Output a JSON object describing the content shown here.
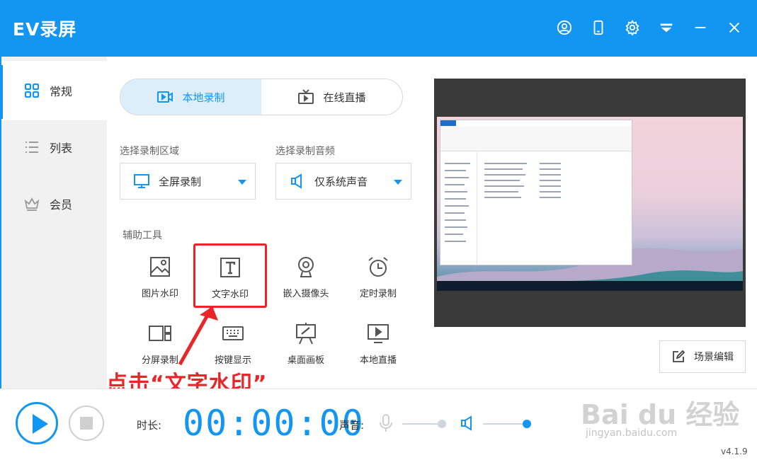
{
  "app": {
    "title": "EV录屏",
    "accent": "#1296f1",
    "version": "v4.1.9"
  },
  "titlebar_icons": [
    "user-icon",
    "phone-icon",
    "settings-icon",
    "skin-icon",
    "minimize-icon",
    "close-icon"
  ],
  "sidebar": {
    "items": [
      {
        "label": "常规",
        "icon": "grid-icon",
        "active": true
      },
      {
        "label": "列表",
        "icon": "list-icon",
        "active": false
      },
      {
        "label": "会员",
        "icon": "crown-icon",
        "active": false
      }
    ]
  },
  "mode_tabs": [
    {
      "label": "本地录制",
      "icon": "record-icon",
      "active": true
    },
    {
      "label": "在线直播",
      "icon": "tv-icon",
      "active": false
    }
  ],
  "area": {
    "label": "选择录制区域",
    "value": "全屏录制",
    "icon": "monitor-icon"
  },
  "audio": {
    "label": "选择录制音频",
    "value": "仅系统声音",
    "icon": "speaker-icon"
  },
  "tools": {
    "label": "辅助工具",
    "items": [
      {
        "label": "图片水印",
        "icon": "image-icon"
      },
      {
        "label": "文字水印",
        "icon": "text-icon",
        "highlighted": true
      },
      {
        "label": "嵌入摄像头",
        "icon": "webcam-icon"
      },
      {
        "label": "定时录制",
        "icon": "alarm-icon"
      },
      {
        "label": "分屏录制",
        "icon": "split-screen-icon"
      },
      {
        "label": "按键显示",
        "icon": "keyboard-icon"
      },
      {
        "label": "桌面画板",
        "icon": "easel-icon"
      },
      {
        "label": "本地直播",
        "icon": "play-screen-icon"
      }
    ]
  },
  "annotation": {
    "text": "点击“文字水印”",
    "color": "#e8262a"
  },
  "scene_edit": {
    "label": "场景编辑"
  },
  "bottom": {
    "duration_label": "时长:",
    "timer": "00:00:00",
    "volume_label": "声音:",
    "mic_level": 0.9,
    "speaker_level": 1.0
  },
  "watermark": {
    "main": "Bai du 经验",
    "sub": "jingyan.baidu.com"
  }
}
